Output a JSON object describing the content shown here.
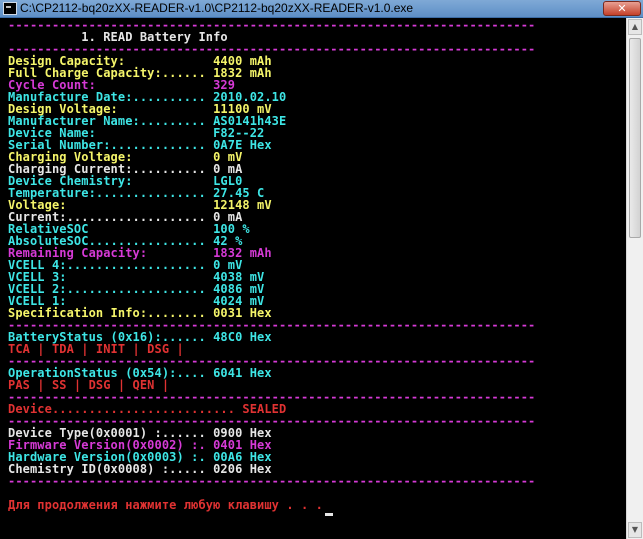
{
  "window": {
    "title": "C:\\CP2112-bq20zXX-READER-v1.0\\CP2112-bq20zXX-READER-v1.0.exe",
    "close_label": "✕"
  },
  "console": {
    "lines": [
      {
        "text": "------------------------------------------------------------------------",
        "color": "m"
      },
      {
        "text": "          1. READ Battery Info",
        "color": "w"
      },
      {
        "text": "------------------------------------------------------------------------",
        "color": "m"
      },
      {
        "text": "Design Capacity:            4400 mAh",
        "color": "y"
      },
      {
        "text": "Full Charge Capacity:...... 1832 mAh",
        "color": "y"
      },
      {
        "text": "Cycle Count:                329",
        "color": "m"
      },
      {
        "text": "Manufacture Date:.......... 2010.02.10",
        "color": "c"
      },
      {
        "text": "Design Voltage:             11100 mV",
        "color": "y"
      },
      {
        "text": "Manufacturer Name:......... AS0141h43E",
        "color": "c"
      },
      {
        "text": "Device Name:                F82--22",
        "color": "c"
      },
      {
        "text": "Serial Number:............. 0A7E Hex",
        "color": "c"
      },
      {
        "text": "Charging Voltage:           0 mV",
        "color": "y"
      },
      {
        "text": "Charging Current:.......... 0 mA",
        "color": "w"
      },
      {
        "text": "Device Chemistry:           LGL0",
        "color": "c"
      },
      {
        "text": "Temperature:............... 27.45 C",
        "color": "c"
      },
      {
        "text": "Voltage:                    12148 mV",
        "color": "y"
      },
      {
        "text": "Current:................... 0 mA",
        "color": "w"
      },
      {
        "text": "RelativeSOC                 100 %",
        "color": "c"
      },
      {
        "text": "AbsoluteSOC................ 42 %",
        "color": "c"
      },
      {
        "text": "Remaining Capacity:         1832 mAh",
        "color": "m"
      },
      {
        "text": "VCELL 4:................... 0 mV",
        "color": "c"
      },
      {
        "text": "VCELL 3:                    4038 mV",
        "color": "c"
      },
      {
        "text": "VCELL 2:................... 4086 mV",
        "color": "c"
      },
      {
        "text": "VCELL 1:                    4024 mV",
        "color": "c"
      },
      {
        "text": "Specification Info:........ 0031 Hex",
        "color": "y"
      },
      {
        "text": "------------------------------------------------------------------------",
        "color": "m"
      },
      {
        "text": "BatteryStatus (0x16):...... 48C0 Hex",
        "color": "c"
      },
      {
        "text": "TCA | TDA | INIT | DSG |",
        "color": "r"
      },
      {
        "text": "------------------------------------------------------------------------",
        "color": "m"
      },
      {
        "text": "OperationStatus (0x54):.... 6041 Hex",
        "color": "c"
      },
      {
        "text": "PAS | SS | DSG | QEN |",
        "color": "r"
      },
      {
        "text": "------------------------------------------------------------------------",
        "color": "m"
      },
      {
        "text": "Device......................... SEALED",
        "color": "r"
      },
      {
        "text": "------------------------------------------------------------------------",
        "color": "m"
      },
      {
        "text": "Device Type(0x0001) :...... 0900 Hex",
        "color": "w"
      },
      {
        "text": "Firmware Version(0x0002) :. 0401 Hex",
        "color": "m"
      },
      {
        "text": "Hardware Version(0x0003) :. 00A6 Hex",
        "color": "c"
      },
      {
        "text": "Chemistry ID(0x0008) :..... 0206 Hex",
        "color": "w"
      },
      {
        "text": "------------------------------------------------------------------------",
        "color": "m"
      },
      {
        "text": "",
        "color": "w"
      },
      {
        "text": "Для продолжения нажмите любую клавишу . . .",
        "color": "r",
        "cursor": true
      }
    ]
  },
  "icons": {
    "app": "console-app-icon",
    "scroll_up": "▲",
    "scroll_down": "▼"
  },
  "colors": {
    "w": "#e6e6e6",
    "y": "#f5f56a",
    "c": "#3ee6e6",
    "m": "#d63ad6",
    "r": "#e03232"
  }
}
